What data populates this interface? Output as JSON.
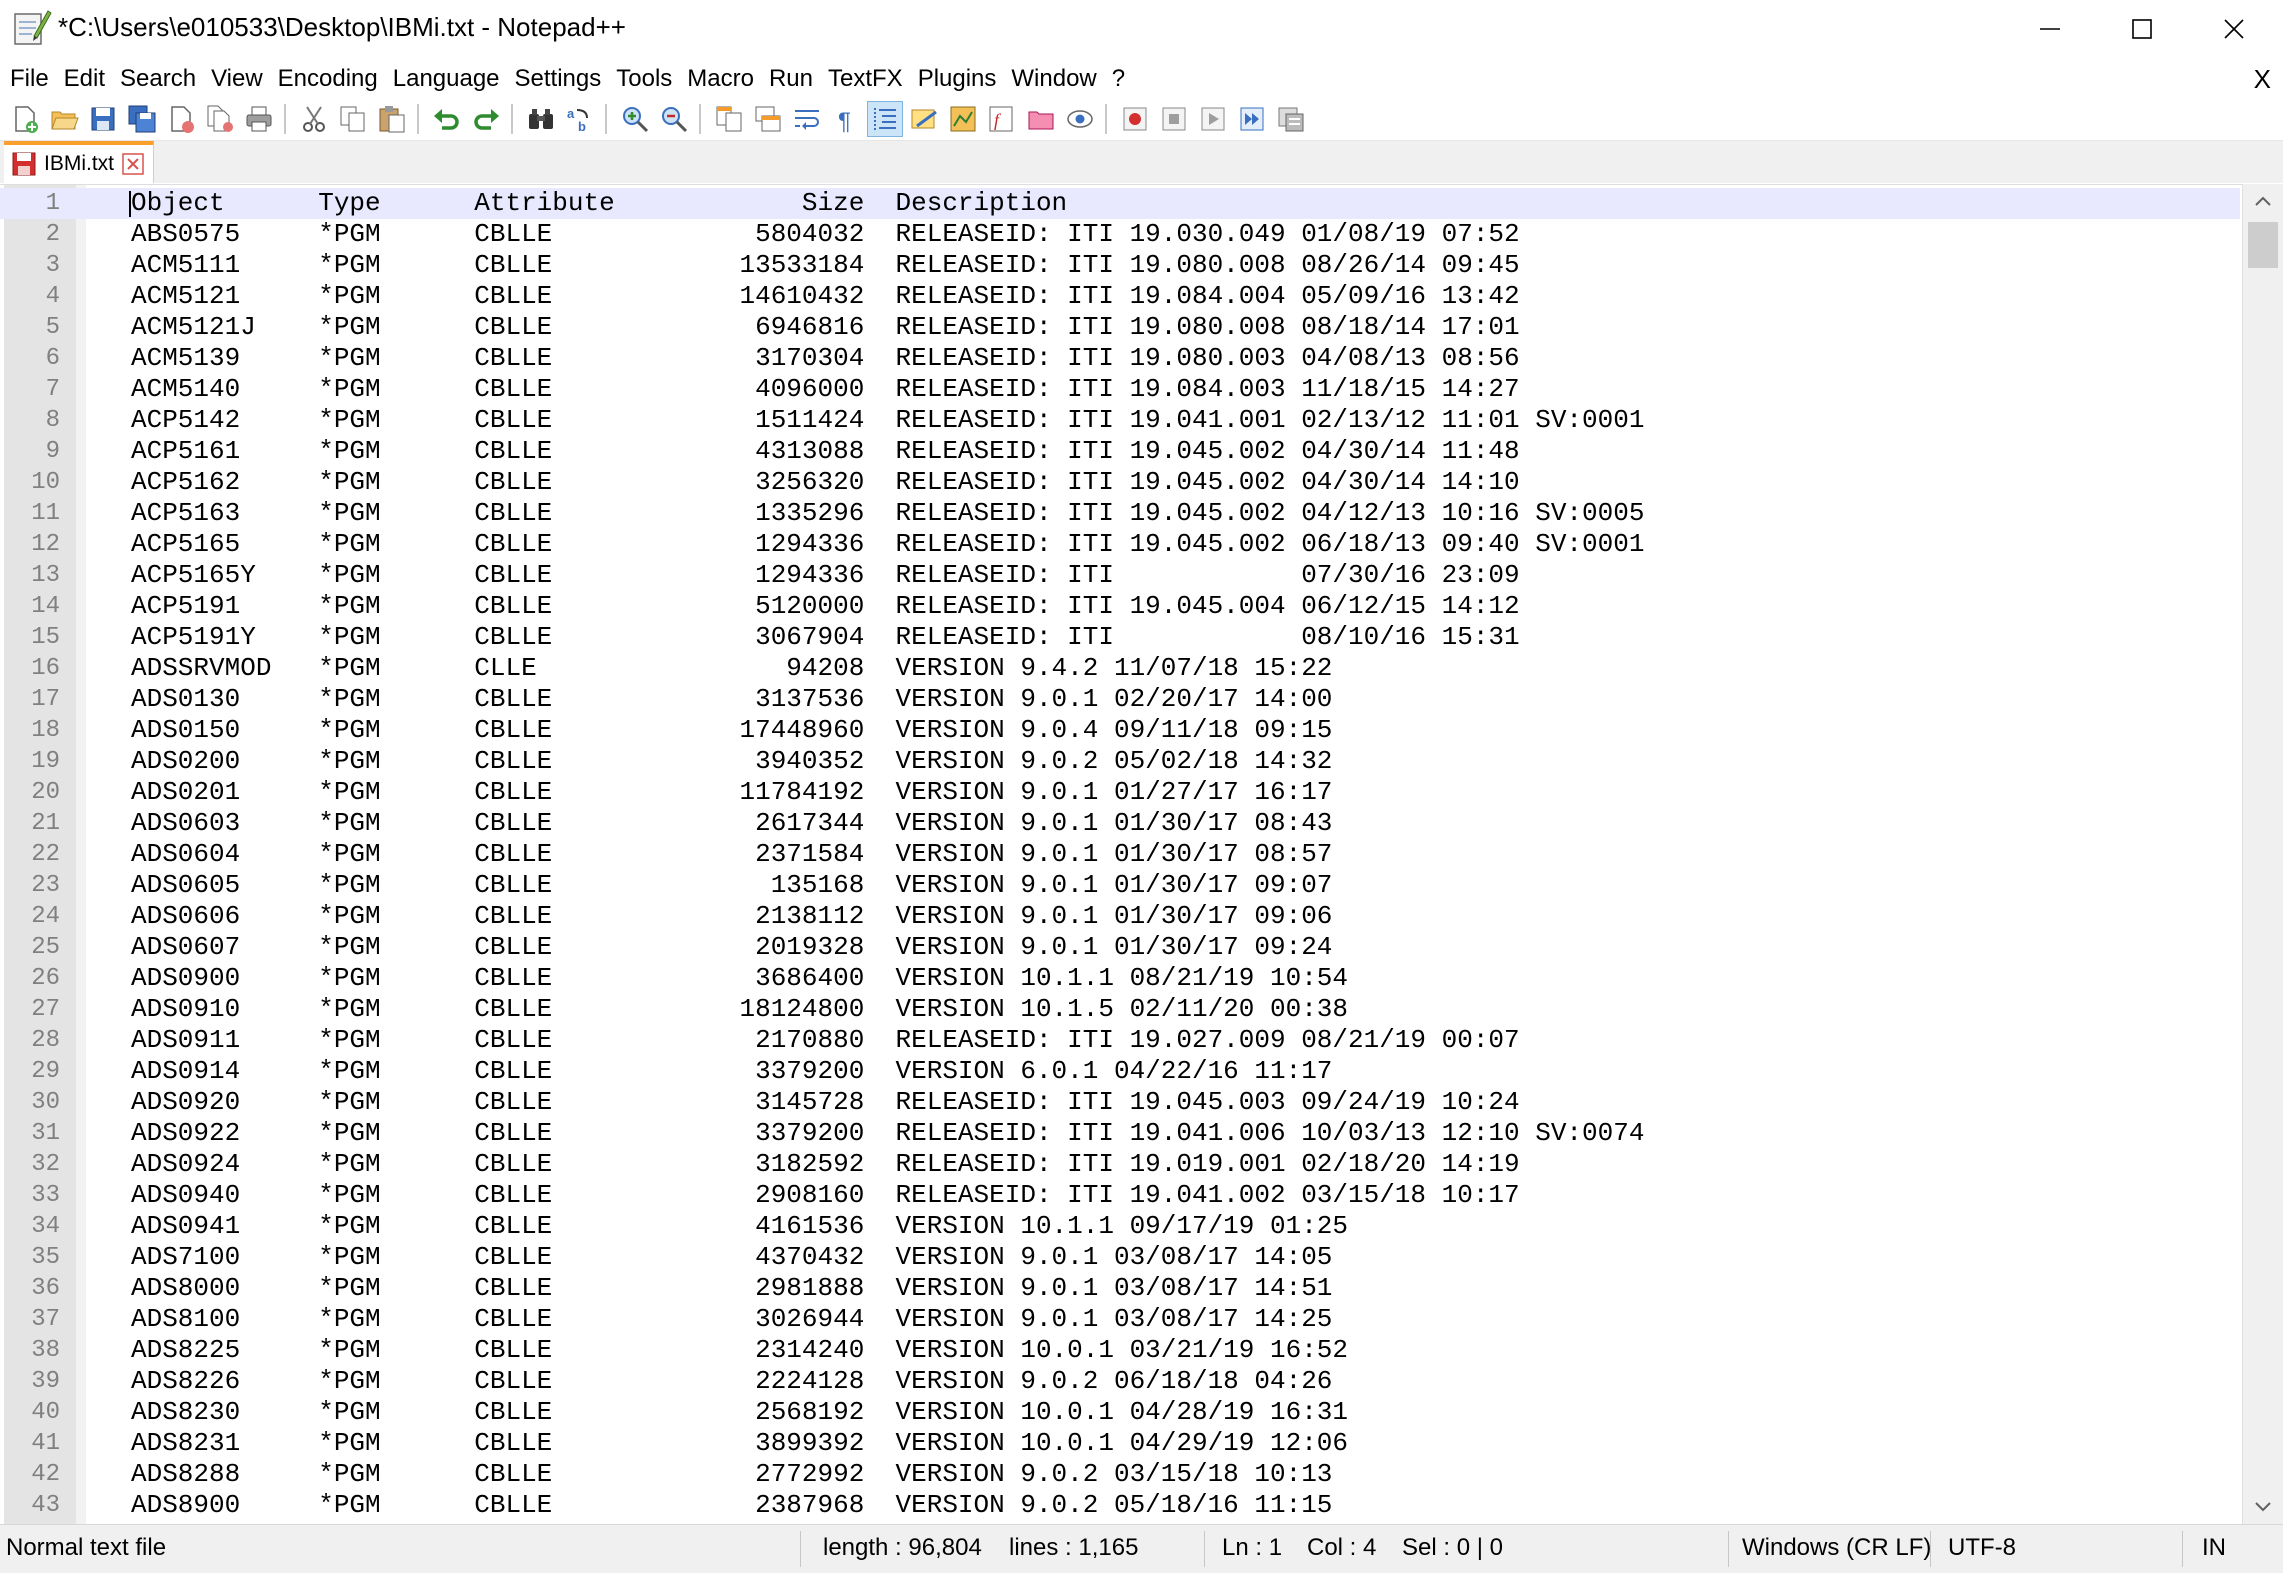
{
  "window": {
    "title": "*C:\\Users\\e010533\\Desktop\\IBMi.txt - Notepad++"
  },
  "menu": {
    "items": [
      "File",
      "Edit",
      "Search",
      "View",
      "Encoding",
      "Language",
      "Settings",
      "Tools",
      "Macro",
      "Run",
      "TextFX",
      "Plugins",
      "Window",
      "?"
    ],
    "close_label": "X"
  },
  "toolbar": {
    "icons": [
      "new-file-icon",
      "open-file-icon",
      "save-icon",
      "save-all-icon",
      "close-icon",
      "close-all-icon",
      "print-icon",
      "cut-icon",
      "copy-icon",
      "paste-icon",
      "undo-icon",
      "redo-icon",
      "find-icon",
      "replace-icon",
      "zoom-in-icon",
      "zoom-out-icon",
      "sync-vertical-icon",
      "sync-horizontal-icon",
      "word-wrap-icon",
      "show-all-characters-icon",
      "indent-guide-icon",
      "user-defined-language-icon",
      "document-map-icon",
      "function-list-icon",
      "folder-as-workspace-icon",
      "monitoring-icon",
      "record-macro-icon",
      "stop-recording-icon",
      "playback-macro-icon",
      "run-macro-multiple-icon",
      "save-macro-icon"
    ]
  },
  "tab": {
    "label": "IBMi.txt"
  },
  "editor": {
    "lines": [
      "Object      Type      Attribute            Size  Description",
      "ABS0575     *PGM      CBLLE             5804032  RELEASEID: ITI 19.030.049 01/08/19 07:52",
      "ACM5111     *PGM      CBLLE            13533184  RELEASEID: ITI 19.080.008 08/26/14 09:45",
      "ACM5121     *PGM      CBLLE            14610432  RELEASEID: ITI 19.084.004 05/09/16 13:42",
      "ACM5121J    *PGM      CBLLE             6946816  RELEASEID: ITI 19.080.008 08/18/14 17:01",
      "ACM5139     *PGM      CBLLE             3170304  RELEASEID: ITI 19.080.003 04/08/13 08:56",
      "ACM5140     *PGM      CBLLE             4096000  RELEASEID: ITI 19.084.003 11/18/15 14:27",
      "ACP5142     *PGM      CBLLE             1511424  RELEASEID: ITI 19.041.001 02/13/12 11:01 SV:0001",
      "ACP5161     *PGM      CBLLE             4313088  RELEASEID: ITI 19.045.002 04/30/14 11:48",
      "ACP5162     *PGM      CBLLE             3256320  RELEASEID: ITI 19.045.002 04/30/14 14:10",
      "ACP5163     *PGM      CBLLE             1335296  RELEASEID: ITI 19.045.002 04/12/13 10:16 SV:0005",
      "ACP5165     *PGM      CBLLE             1294336  RELEASEID: ITI 19.045.002 06/18/13 09:40 SV:0001",
      "ACP5165Y    *PGM      CBLLE             1294336  RELEASEID: ITI            07/30/16 23:09",
      "ACP5191     *PGM      CBLLE             5120000  RELEASEID: ITI 19.045.004 06/12/15 14:12",
      "ACP5191Y    *PGM      CBLLE             3067904  RELEASEID: ITI            08/10/16 15:31",
      "ADSSRVMOD   *PGM      CLLE                94208  VERSION 9.4.2 11/07/18 15:22",
      "ADS0130     *PGM      CBLLE             3137536  VERSION 9.0.1 02/20/17 14:00",
      "ADS0150     *PGM      CBLLE            17448960  VERSION 9.0.4 09/11/18 09:15",
      "ADS0200     *PGM      CBLLE             3940352  VERSION 9.0.2 05/02/18 14:32",
      "ADS0201     *PGM      CBLLE            11784192  VERSION 9.0.1 01/27/17 16:17",
      "ADS0603     *PGM      CBLLE             2617344  VERSION 9.0.1 01/30/17 08:43",
      "ADS0604     *PGM      CBLLE             2371584  VERSION 9.0.1 01/30/17 08:57",
      "ADS0605     *PGM      CBLLE              135168  VERSION 9.0.1 01/30/17 09:07",
      "ADS0606     *PGM      CBLLE             2138112  VERSION 9.0.1 01/30/17 09:06",
      "ADS0607     *PGM      CBLLE             2019328  VERSION 9.0.1 01/30/17 09:24",
      "ADS0900     *PGM      CBLLE             3686400  VERSION 10.1.1 08/21/19 10:54",
      "ADS0910     *PGM      CBLLE            18124800  VERSION 10.1.5 02/11/20 00:38",
      "ADS0911     *PGM      CBLLE             2170880  RELEASEID: ITI 19.027.009 08/21/19 00:07",
      "ADS0914     *PGM      CBLLE             3379200  VERSION 6.0.1 04/22/16 11:17",
      "ADS0920     *PGM      CBLLE             3145728  RELEASEID: ITI 19.045.003 09/24/19 10:24",
      "ADS0922     *PGM      CBLLE             3379200  RELEASEID: ITI 19.041.006 10/03/13 12:10 SV:0074",
      "ADS0924     *PGM      CBLLE             3182592  RELEASEID: ITI 19.019.001 02/18/20 14:19",
      "ADS0940     *PGM      CBLLE             2908160  RELEASEID: ITI 19.041.002 03/15/18 10:17",
      "ADS0941     *PGM      CBLLE             4161536  VERSION 10.1.1 09/17/19 01:25",
      "ADS7100     *PGM      CBLLE             4370432  VERSION 9.0.1 03/08/17 14:05",
      "ADS8000     *PGM      CBLLE             2981888  VERSION 9.0.1 03/08/17 14:51",
      "ADS8100     *PGM      CBLLE             3026944  VERSION 9.0.1 03/08/17 14:25",
      "ADS8225     *PGM      CBLLE             2314240  VERSION 10.0.1 03/21/19 16:52",
      "ADS8226     *PGM      CBLLE             2224128  VERSION 9.0.2 06/18/18 04:26",
      "ADS8230     *PGM      CBLLE             2568192  VERSION 10.0.1 04/28/19 16:31",
      "ADS8231     *PGM      CBLLE             3899392  VERSION 10.0.1 04/29/19 12:06",
      "ADS8288     *PGM      CBLLE             2772992  VERSION 9.0.2 03/15/18 10:13",
      "ADS8900     *PGM      CBLLE             2387968  VERSION 9.0.2 05/18/16 11:15"
    ]
  },
  "status": {
    "file_type": "Normal text file",
    "length": "length : 96,804",
    "lines": "lines : 1,165",
    "ln": "Ln : 1",
    "col": "Col : 4",
    "sel": "Sel : 0 | 0",
    "eol": "Windows (CR LF)",
    "encoding": "UTF-8",
    "mode": "IN"
  }
}
